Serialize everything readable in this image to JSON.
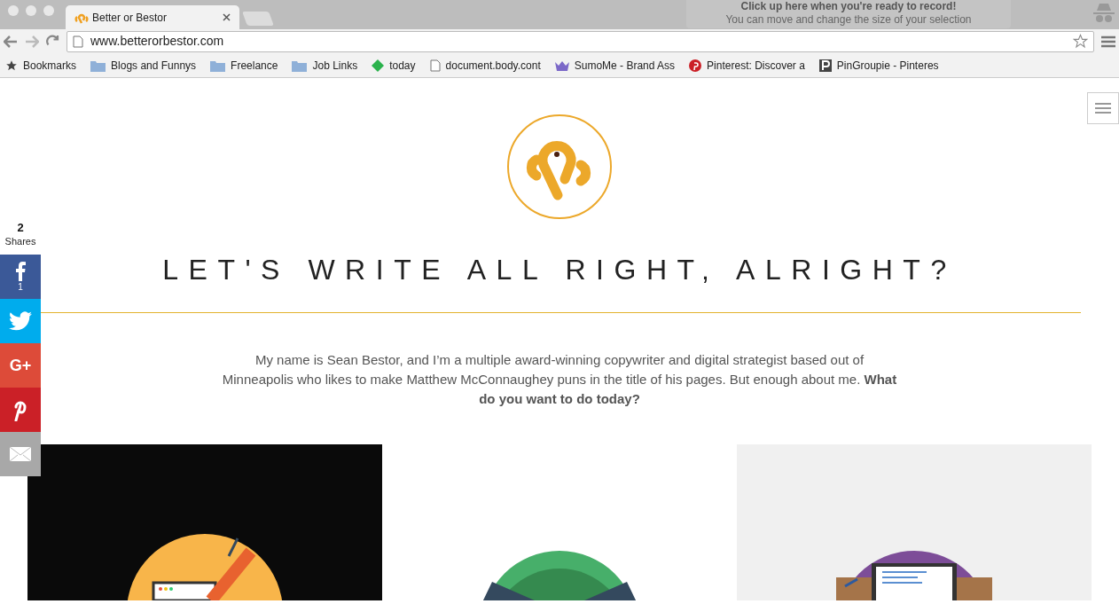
{
  "browser": {
    "tab": {
      "title": "Better or Bestor"
    },
    "url": "www.betterorbestor.com",
    "bookmarks": [
      {
        "kind": "star",
        "label": "Bookmarks"
      },
      {
        "kind": "folder",
        "label": "Blogs and Funnys"
      },
      {
        "kind": "folder",
        "label": "Freelance"
      },
      {
        "kind": "folder",
        "label": "Job Links"
      },
      {
        "kind": "feed",
        "label": "today"
      },
      {
        "kind": "page",
        "label": "document.body.cont"
      },
      {
        "kind": "crown",
        "label": "SumoMe - Brand Ass"
      },
      {
        "kind": "pinterest",
        "label": "Pinterest: Discover a"
      },
      {
        "kind": "p",
        "label": "PinGroupie - Pinteres"
      }
    ]
  },
  "recorder_overlay": {
    "title": "Click up here when you're ready to record!",
    "hint": "You can move and change the size of your selection"
  },
  "share_bar": {
    "count": "2",
    "label": "Shares",
    "buttons": [
      {
        "kind": "facebook",
        "count": "1"
      },
      {
        "kind": "twitter"
      },
      {
        "kind": "googleplus",
        "glyph": "G+"
      },
      {
        "kind": "pinterest"
      },
      {
        "kind": "email"
      }
    ]
  },
  "page": {
    "heading": "LET'S WRITE ALL RIGHT, ALRIGHT?",
    "intro": "My name is Sean Bestor, and I’m a multiple award-winning copywriter and digital strategist based out of Minneapolis who likes to make Matthew McConnaughey puns in the title of his pages. But enough about me. **What do you want to do today?**",
    "cards": [
      {
        "kind": "writing"
      },
      {
        "kind": "green"
      },
      {
        "kind": "laptop"
      }
    ]
  }
}
